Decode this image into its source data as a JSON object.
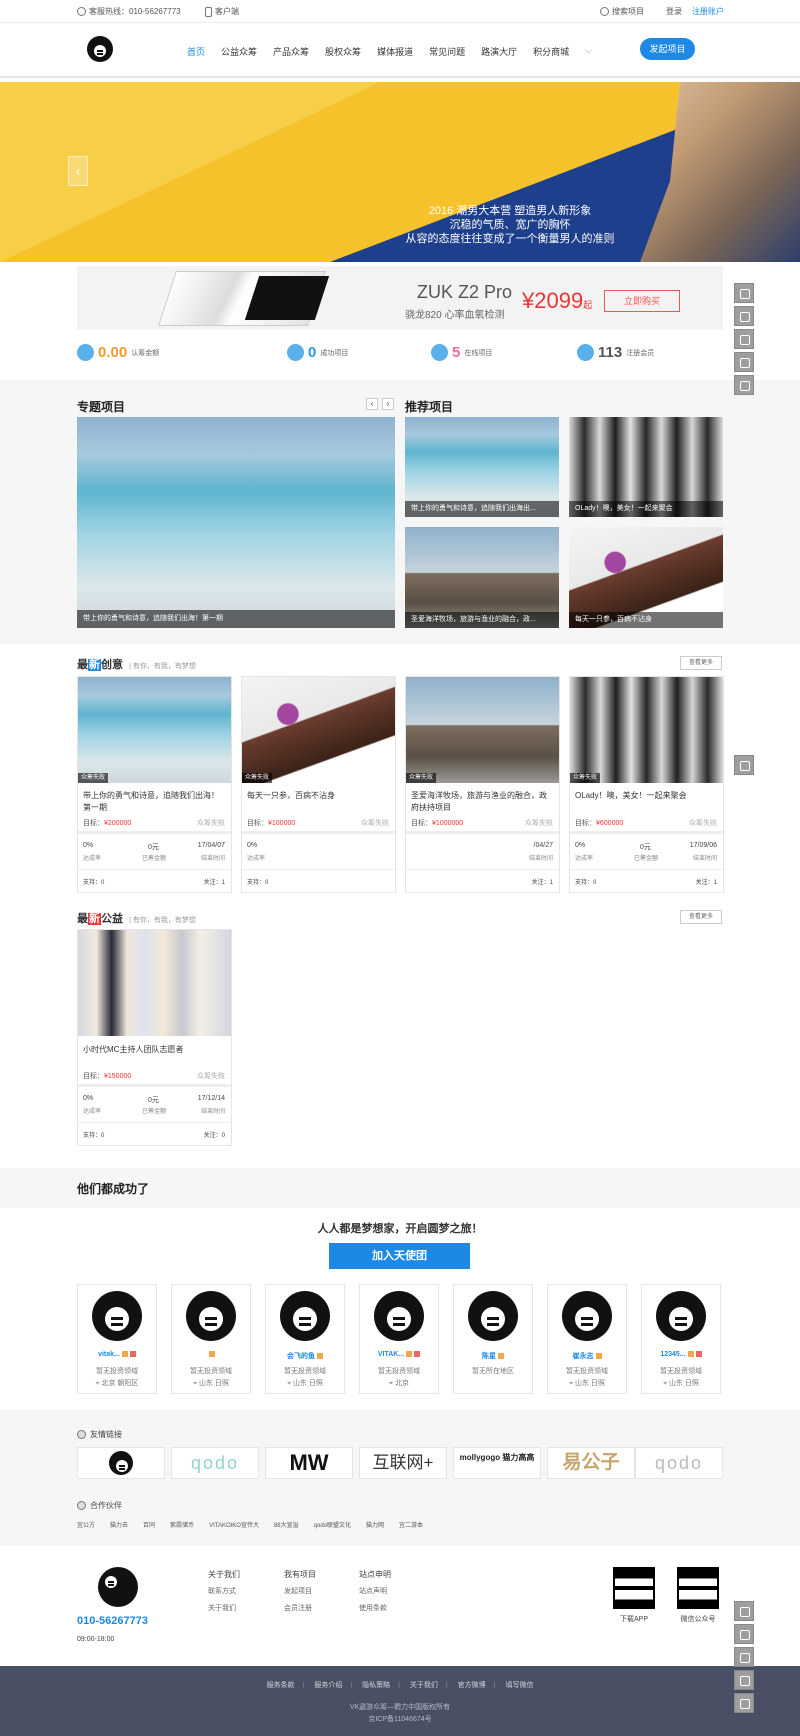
{
  "topbar": {
    "hotline": "客服热线：010-56267773",
    "client": "客户端",
    "search": "搜索项目",
    "login": "登录",
    "register": "注册账户"
  },
  "nav": {
    "items": [
      "首页",
      "公益众筹",
      "产品众筹",
      "股权众筹",
      "媒体报道",
      "常见问题",
      "路演大厅",
      "积分商城"
    ],
    "launch": "发起项目"
  },
  "banner": {
    "line1": "2016 潮男大本营 塑造男人新形象",
    "line2": "沉稳的气质、宽广的胸怀",
    "line3": "从容的态度往往变成了一个衡量男人的准则"
  },
  "ad": {
    "title": "ZUK Z2 Pro",
    "sub": "骁龙820 心率血氧检测",
    "price": "¥2099",
    "price_suffix": "起",
    "buy": "立即购买"
  },
  "stats": [
    {
      "num": "0.00",
      "label": "认筹金额",
      "color": "#2a9be0",
      "circle": "#58b1ea"
    },
    {
      "num": "0",
      "label": "成功项目",
      "color": "#2a9be0",
      "circle": "#58b1ea"
    },
    {
      "num": "5",
      "label": "在线项目",
      "color": "#e86aa9",
      "circle": "#58b1ea"
    },
    {
      "num": "113",
      "label": "注册会员",
      "color": "#555555",
      "circle": "#58b1ea"
    }
  ],
  "featured": {
    "title": "专题项目",
    "main_caption": "带上你的勇气和诗意，追随我们出海！第一期",
    "recommend_title": "推荐项目",
    "recommend": [
      "带上你的勇气和诗意，追随我们出海出...",
      "OLady！噢，美女！一起来聚会",
      "圣爱海洋牧场，旅游与渔业的融合，政...",
      "每天一只参，百病不沾身"
    ]
  },
  "creative": {
    "title_a": "最",
    "title_b": "新",
    "title_c": "创意",
    "sub": "| 有你，有我，有梦想",
    "more": "查看更多",
    "projects": [
      {
        "tag": "众筹失败",
        "name": "带上你的勇气和诗意，追随我们出海！第一期",
        "goal_label": "目标：",
        "goal": "¥200000",
        "status": "众筹失败",
        "p1": "0%",
        "l1": "达成率",
        "p2": "0元",
        "l2": "已筹金额",
        "p3": "17/04/07",
        "l3": "结束时间",
        "s1": "支持：0",
        "s2": "关注：1"
      },
      {
        "tag": "众筹失败",
        "name": "每天一只参，百病不沾身",
        "goal_label": "目标：",
        "goal": "¥100000",
        "status": "众筹失败",
        "p1": "0%",
        "l1": "达成率",
        "p2": "",
        "l2": "",
        "p3": "",
        "l3": "",
        "s1": "支持：0",
        "s2": ""
      },
      {
        "tag": "众筹失败",
        "name": "圣爱海洋牧场，旅游与渔业的融合，政府扶持项目",
        "goal_label": "目标：",
        "goal": "¥1000000",
        "status": "众筹失败",
        "p1": "",
        "l1": "",
        "p2": "",
        "l2": "",
        "p3": "/04/27",
        "l3": "结束时间",
        "s1": "",
        "s2": "关注：1"
      },
      {
        "tag": "众筹失败",
        "name": "OLady！噢，美女！一起来聚会",
        "goal_label": "目标：",
        "goal": "¥600000",
        "status": "众筹失败",
        "p1": "0%",
        "l1": "达成率",
        "p2": "0元",
        "l2": "已筹金额",
        "p3": "17/09/06",
        "l3": "结束时间",
        "s1": "支持：0",
        "s2": "关注：1"
      }
    ]
  },
  "charity": {
    "title_a": "最",
    "title_b": "新",
    "title_c": "公益",
    "sub": "| 有你，有我，有梦想",
    "more": "查看更多",
    "project": {
      "name": "小时代MC主持人团队志愿者",
      "goal_label": "目标：",
      "goal": "¥150000",
      "status": "众筹失败",
      "p1": "0%",
      "l1": "达成率",
      "p2": "0元",
      "l2": "已筹金额",
      "p3": "17/12/14",
      "l3": "结束时间",
      "s1": "支持：0",
      "s2": "关注：0"
    }
  },
  "success": {
    "title": "他们都成功了",
    "slogan": "人人都是梦想家，开启圆梦之旅！",
    "join": "加入天使团",
    "members": [
      {
        "name": "vitak...",
        "t1": "暂无投资领域",
        "t2": "北京 朝阳区"
      },
      {
        "name": "",
        "t1": "暂无投资领域",
        "t2": "山东 日照"
      },
      {
        "name": "会飞的鱼",
        "t1": "暂无投资领域",
        "t2": "山东 日照"
      },
      {
        "name": "VITAK...",
        "t1": "暂无投资领域",
        "t2": "北京"
      },
      {
        "name": "陈星",
        "t1": "暂无所在地区",
        "t2": ""
      },
      {
        "name": "崔永志",
        "t1": "暂无投资领域",
        "t2": "山东 日照"
      },
      {
        "name": "12345...",
        "t1": "暂无投资领域",
        "t2": "山东 日照"
      }
    ]
  },
  "links": {
    "title": "友情链接",
    "items": [
      "",
      "qodo",
      "MW",
      "互联网+",
      "mollygogo 猫力高高",
      "易公子",
      "qodo"
    ],
    "partner_title": "合作伙伴",
    "partners": [
      "宜公方",
      "猫力去",
      "百同",
      "紫霞储币",
      "VITAKOIKO宣传大",
      "88大宣溢",
      "qodo联盟文化",
      "猫力网",
      "宜二游本"
    ]
  },
  "footer": {
    "phone": "010-56267773",
    "hours": "09:00-18:00",
    "col1": {
      "title": "关于我们",
      "a": "联系方式",
      "b": "关于我们"
    },
    "col2": {
      "title": "我有项目",
      "a": "发起项目",
      "b": "会员注册"
    },
    "col3": {
      "title": "站点申明",
      "a": "站点声明",
      "b": "使用条款"
    },
    "qr1": "下载APP",
    "qr2": "微信公众号",
    "bottom_links": [
      "服务条款",
      "服务介绍",
      "隐私策略",
      "关于我们",
      "官方微博",
      "填写微信"
    ],
    "copy1": "VK遨游众筹—聘力中国版权所有",
    "copy2": "京ICP备11046674号"
  }
}
